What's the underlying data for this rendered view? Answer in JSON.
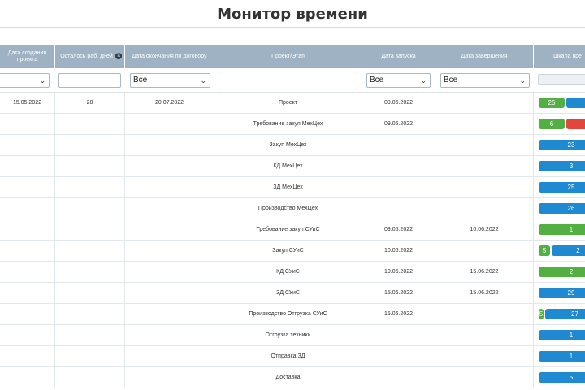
{
  "title": "Монитор времени",
  "columns": [
    "Дата создания проекта",
    "Осталось раб. дней",
    "Дата окончания по договору",
    "Проект/Этап",
    "Дата запуска",
    "Дата завершения",
    "Шкала вре"
  ],
  "sort_icon": "sort-icon",
  "filters": {
    "end_date_select": "Все",
    "start_select": "Все",
    "finish_select": "Все",
    "chevron": "⌄"
  },
  "colors": {
    "header_bg": "#9eb2c3",
    "bar_blue": "#1f8ad1",
    "bar_green": "#52b043",
    "bar_red": "#e2463f"
  },
  "rows": [
    {
      "created": "15.05.2022",
      "days_left": "28",
      "contract_end": "20.07.2022",
      "stage": "Проект",
      "start": "09.06.2022",
      "finish": "",
      "bars": [
        {
          "color": "green",
          "label": "25",
          "frac": 0.55
        },
        {
          "color": "blue",
          "label": "",
          "frac": 0.45
        }
      ]
    },
    {
      "created": "",
      "days_left": "",
      "contract_end": "",
      "stage": "Требование закуп МехЦех",
      "start": "09.06.2022",
      "finish": "",
      "bars": [
        {
          "color": "green",
          "label": "6",
          "frac": 0.55
        },
        {
          "color": "red",
          "label": "",
          "frac": 0.45
        }
      ]
    },
    {
      "created": "",
      "days_left": "",
      "contract_end": "",
      "stage": "Закуп МехЦех",
      "start": "",
      "finish": "",
      "bars": [
        {
          "color": "blue",
          "label": "23",
          "frac": 1
        }
      ]
    },
    {
      "created": "",
      "days_left": "",
      "contract_end": "",
      "stage": "КД МехЦех",
      "start": "",
      "finish": "",
      "bars": [
        {
          "color": "blue",
          "label": "3",
          "frac": 1
        }
      ]
    },
    {
      "created": "",
      "days_left": "",
      "contract_end": "",
      "stage": "ЗД МехЦех",
      "start": "",
      "finish": "",
      "bars": [
        {
          "color": "blue",
          "label": "25",
          "frac": 1
        }
      ]
    },
    {
      "created": "",
      "days_left": "",
      "contract_end": "",
      "stage": "Производство МехЦех",
      "start": "",
      "finish": "",
      "bars": [
        {
          "color": "blue",
          "label": "26",
          "frac": 1
        }
      ]
    },
    {
      "created": "",
      "days_left": "",
      "contract_end": "",
      "stage": "Требование закуп СУиС",
      "start": "09.06.2022",
      "finish": "10.06.2022",
      "bars": [
        {
          "color": "green",
          "label": "1",
          "frac": 1
        }
      ]
    },
    {
      "created": "",
      "days_left": "",
      "contract_end": "",
      "stage": "Закуп СУиС",
      "start": "10.06.2022",
      "finish": "",
      "bars": [
        {
          "color": "green",
          "label": "5",
          "frac": 0.25
        },
        {
          "color": "blue",
          "label": "2",
          "frac": 0.75
        }
      ]
    },
    {
      "created": "",
      "days_left": "",
      "contract_end": "",
      "stage": "КД СУиС",
      "start": "10.06.2022",
      "finish": "15.06.2022",
      "bars": [
        {
          "color": "green",
          "label": "2",
          "frac": 1
        }
      ]
    },
    {
      "created": "",
      "days_left": "",
      "contract_end": "",
      "stage": "ЗД СУиС",
      "start": "15.06.2022",
      "finish": "15.06.2022",
      "bars": [
        {
          "color": "blue",
          "label": "29",
          "frac": 1
        }
      ]
    },
    {
      "created": "",
      "days_left": "",
      "contract_end": "",
      "stage": "Производство Отгрузка СУиС",
      "start": "15.06.2022",
      "finish": "",
      "bars": [
        {
          "color": "green",
          "label": "5",
          "frac": 0.12
        },
        {
          "color": "blue",
          "label": "27",
          "frac": 0.88
        }
      ]
    },
    {
      "created": "",
      "days_left": "",
      "contract_end": "",
      "stage": "Отгрузка техники",
      "start": "",
      "finish": "",
      "bars": [
        {
          "color": "blue",
          "label": "1",
          "frac": 1
        }
      ]
    },
    {
      "created": "",
      "days_left": "",
      "contract_end": "",
      "stage": "Отправка ЗД",
      "start": "",
      "finish": "",
      "bars": [
        {
          "color": "blue",
          "label": "1",
          "frac": 1
        }
      ]
    },
    {
      "created": "",
      "days_left": "",
      "contract_end": "",
      "stage": "Доставка",
      "start": "",
      "finish": "",
      "bars": [
        {
          "color": "blue",
          "label": "5",
          "frac": 1
        }
      ]
    }
  ]
}
